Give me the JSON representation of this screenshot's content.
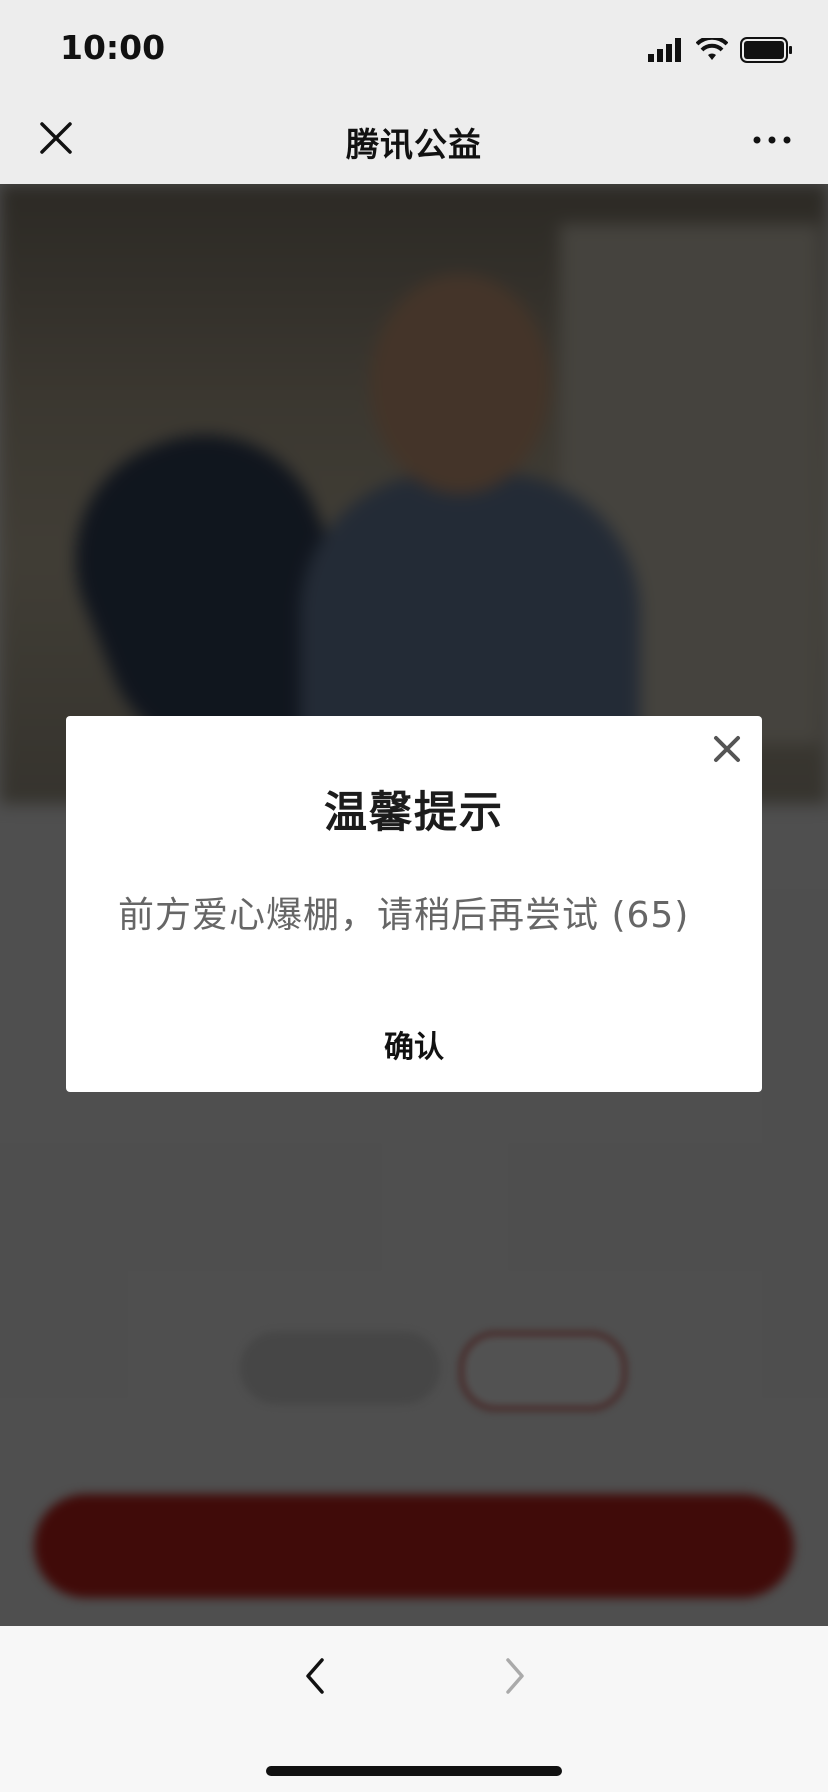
{
  "status_bar": {
    "time": "10:00",
    "icons": [
      "cellular-signal-icon",
      "wifi-icon",
      "battery-icon"
    ]
  },
  "nav": {
    "title": "腾讯公益",
    "close_icon": "close-icon",
    "more_icon": "more-icon"
  },
  "dialog": {
    "title": "温馨提示",
    "message": "前方爱心爆棚，请稍后再尝试 (65)",
    "confirm_label": "确认",
    "close_icon": "close-icon"
  },
  "toolbar": {
    "back_icon": "chevron-left-icon",
    "forward_icon": "chevron-right-icon"
  },
  "colors": {
    "overlay": "#000000",
    "cta_red": "#c8231d",
    "text_dark": "#1c1c1c",
    "text_gray": "#666666"
  }
}
